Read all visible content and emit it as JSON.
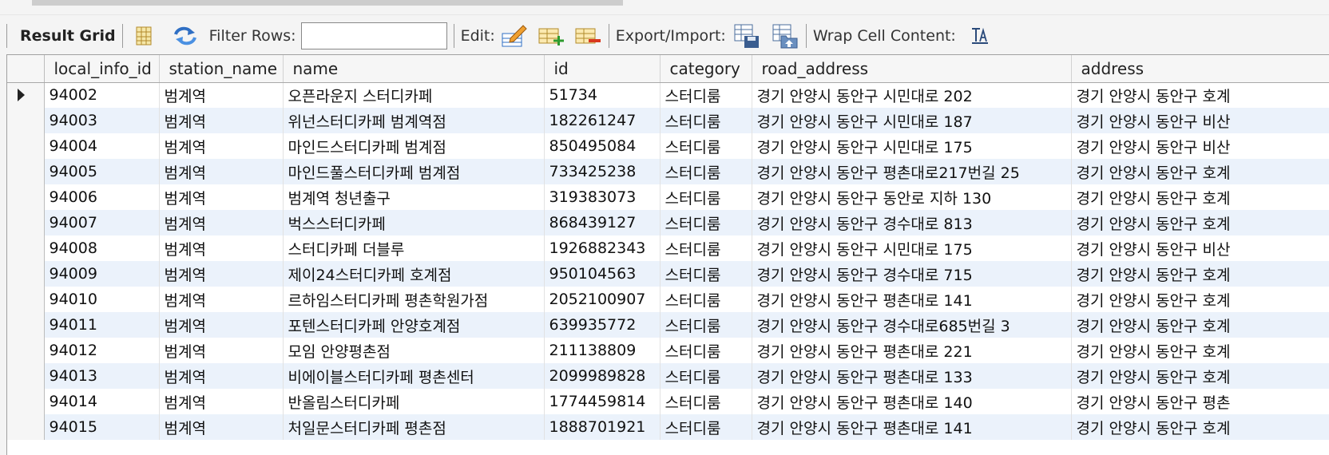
{
  "toolbar": {
    "result_grid_label": "Result Grid",
    "filter_rows_label": "Filter Rows:",
    "filter_rows_value": "",
    "edit_label": "Edit:",
    "export_import_label": "Export/Import:",
    "wrap_cell_label": "Wrap Cell Content:",
    "icons": [
      "grid-view-icon",
      "refresh-icon",
      "edit-row-icon",
      "insert-row-icon",
      "delete-row-icon",
      "export-icon",
      "import-icon",
      "wrap-text-icon"
    ]
  },
  "columns": [
    "local_info_id",
    "station_name",
    "name",
    "id",
    "category",
    "road_address",
    "address"
  ],
  "rows": [
    [
      "94002",
      "범계역",
      "오픈라운지 스터디카페",
      "51734",
      "스터디룸",
      "경기 안양시 동안구 시민대로 202",
      "경기 안양시 동안구 호계"
    ],
    [
      "94003",
      "범계역",
      "위넌스터디카페 범계역점",
      "182261247",
      "스터디룸",
      "경기 안양시 동안구 시민대로 187",
      "경기 안양시 동안구 비산"
    ],
    [
      "94004",
      "범계역",
      "마인드스터디카페 범계점",
      "850495084",
      "스터디룸",
      "경기 안양시 동안구 시민대로 175",
      "경기 안양시 동안구 비산"
    ],
    [
      "94005",
      "범계역",
      "마인드풀스터디카페 범계점",
      "733425238",
      "스터디룸",
      "경기 안양시 동안구 평촌대로217번길 25",
      "경기 안양시 동안구 호계"
    ],
    [
      "94006",
      "범계역",
      "범계역 청년출구",
      "319383073",
      "스터디룸",
      "경기 안양시 동안구 동안로 지하 130",
      "경기 안양시 동안구 호계"
    ],
    [
      "94007",
      "범계역",
      "벅스스터디카페",
      "868439127",
      "스터디룸",
      "경기 안양시 동안구 경수대로 813",
      "경기 안양시 동안구 호계"
    ],
    [
      "94008",
      "범계역",
      "스터디카페 더블루",
      "1926882343",
      "스터디룸",
      "경기 안양시 동안구 시민대로 175",
      "경기 안양시 동안구 비산"
    ],
    [
      "94009",
      "범계역",
      "제이24스터디카페 호계점",
      "950104563",
      "스터디룸",
      "경기 안양시 동안구 경수대로 715",
      "경기 안양시 동안구 호계"
    ],
    [
      "94010",
      "범계역",
      "르하임스터디카페 평촌학원가점",
      "2052100907",
      "스터디룸",
      "경기 안양시 동안구 평촌대로 141",
      "경기 안양시 동안구 호계"
    ],
    [
      "94011",
      "범계역",
      "포텐스터디카페 안양호계점",
      "639935772",
      "스터디룸",
      "경기 안양시 동안구 경수대로685번길 3",
      "경기 안양시 동안구 호계"
    ],
    [
      "94012",
      "범계역",
      "모임 안양평촌점",
      "211138809",
      "스터디룸",
      "경기 안양시 동안구 평촌대로 221",
      "경기 안양시 동안구 호계"
    ],
    [
      "94013",
      "범계역",
      "비에이블스터디카페 평촌센터",
      "2099989828",
      "스터디룸",
      "경기 안양시 동안구 평촌대로 133",
      "경기 안양시 동안구 호계"
    ],
    [
      "94014",
      "범계역",
      "반올림스터디카페",
      "1774459814",
      "스터디룸",
      "경기 안양시 동안구 평촌대로 140",
      "경기 안양시 동안구 평촌"
    ],
    [
      "94015",
      "범계역",
      "처일문스터디카페 평촌점",
      "1888701921",
      "스터디룸",
      "경기 안양시 동안구 평촌대로 141",
      "경기 안양시 동안구 호계"
    ]
  ]
}
